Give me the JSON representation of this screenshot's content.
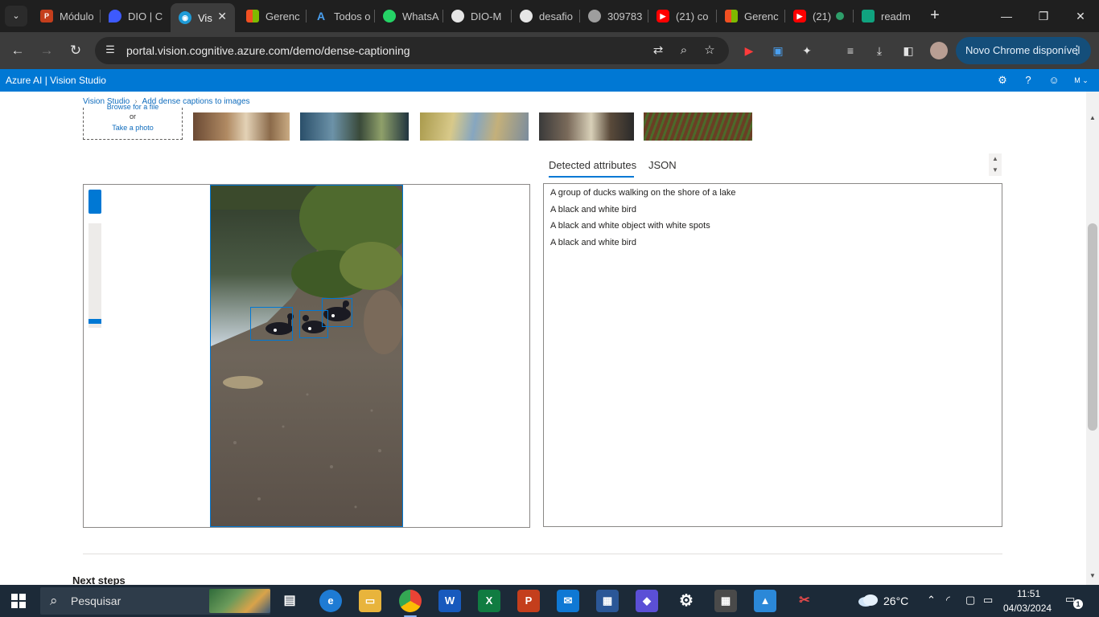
{
  "browser": {
    "tabs": [
      {
        "title": "Módulo",
        "color": "#c43e1c",
        "glyph": "P"
      },
      {
        "title": "DIO | C",
        "color": "#3d5afe",
        "glyph": ""
      },
      {
        "title": "Vis",
        "color": "#1e9bd7",
        "glyph": "",
        "active": true
      },
      {
        "title": "Gerenc",
        "color": "#f25022",
        "glyph": ""
      },
      {
        "title": "Todos o",
        "color": "#0078d4",
        "glyph": "A"
      },
      {
        "title": "WhatsA",
        "color": "#25d366",
        "glyph": ""
      },
      {
        "title": "DIO-M",
        "color": "#e6e6e6",
        "glyph": ""
      },
      {
        "title": "desafio",
        "color": "#e6e6e6",
        "glyph": ""
      },
      {
        "title": "309783",
        "color": "#9e9e9e",
        "glyph": ""
      },
      {
        "title": "(21) co",
        "color": "#ff0000",
        "glyph": "▶"
      },
      {
        "title": "Gerenc",
        "color": "#f25022",
        "glyph": ""
      },
      {
        "title": "(21)",
        "color": "#ff0000",
        "glyph": "▶"
      },
      {
        "title": "readm",
        "color": "#10a37f",
        "glyph": ""
      }
    ],
    "url": "portal.vision.cognitive.azure.com/demo/dense-captioning",
    "update_label": "Novo Chrome disponível"
  },
  "azure": {
    "brand": "Azure AI  |  Vision Studio",
    "profile_initial": "M"
  },
  "page": {
    "breadcrumb": [
      "Vision Studio",
      "Add dense captions to images"
    ],
    "upload": {
      "browse": "Browse for a file",
      "or": "or",
      "photo": "Take a photo"
    },
    "tabs": {
      "attributes": "Detected attributes",
      "json": "JSON"
    },
    "captions": [
      "A group of ducks walking on the shore of a lake",
      "A black and white bird",
      "A black and white object with white spots",
      "A black and white bird"
    ],
    "next_steps": "Next steps"
  },
  "taskbar": {
    "search_placeholder": "Pesquisar",
    "temperature": "26°C",
    "time": "11:51",
    "date": "04/03/2024",
    "notifications": "1"
  },
  "colors": {
    "azure_blue": "#0078d4",
    "chrome_dark": "#1f1f1f",
    "taskbar": "#1c2a38"
  }
}
